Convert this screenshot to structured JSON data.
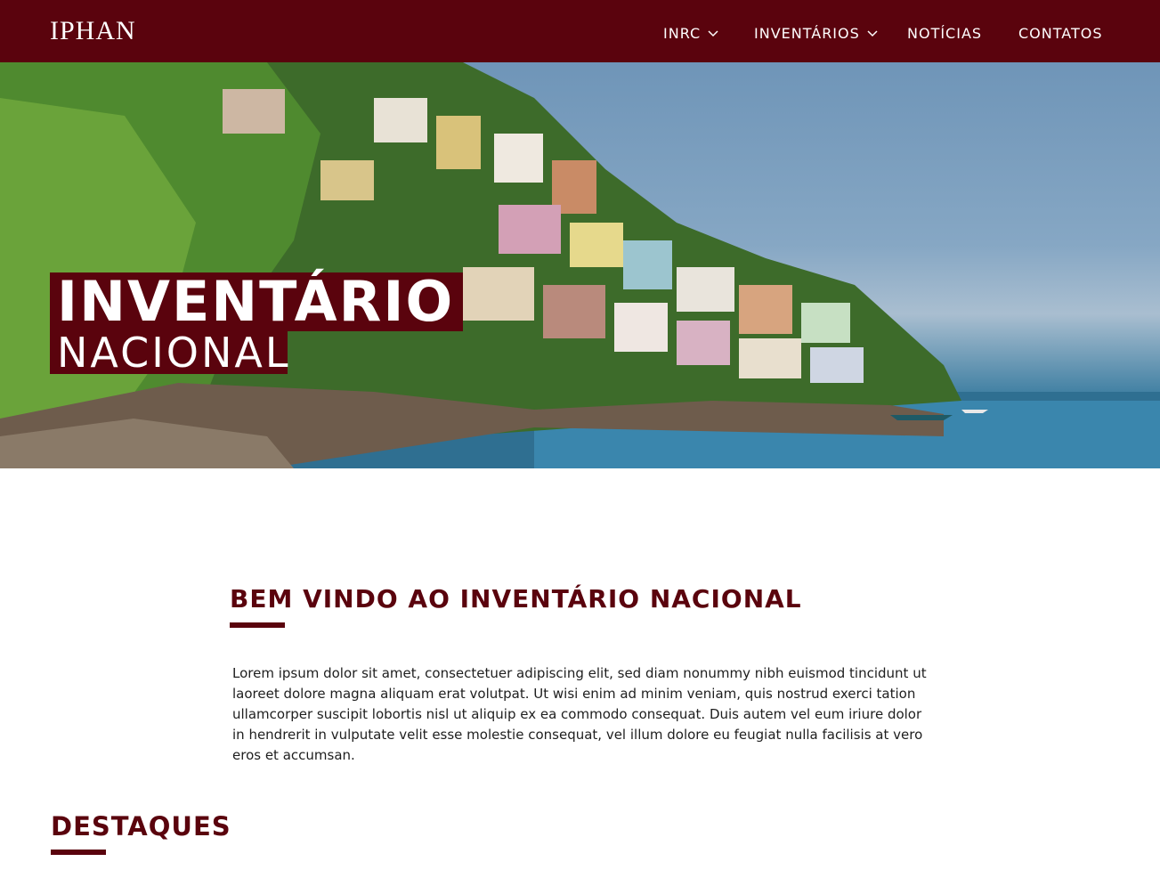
{
  "header": {
    "logo": "IPHAN",
    "nav": [
      {
        "label": "INRC",
        "has_dropdown": true
      },
      {
        "label": "INVENTÁRIOS",
        "has_dropdown": true
      },
      {
        "label": "NOTÍCIAS",
        "has_dropdown": false
      },
      {
        "label": "CONTATOS",
        "has_dropdown": false
      }
    ]
  },
  "hero": {
    "title_line1": "INVENTÁRIO",
    "title_line2": "NACIONAL"
  },
  "welcome": {
    "title": "BEM VINDO AO INVENTÁRIO NACIONAL",
    "body": "Lorem ipsum dolor sit amet, consectetuer adipiscing elit, sed diam nonummy nibh euismod tincidunt ut laoreet dolore magna aliquam erat volutpat. Ut wisi enim ad minim veniam, quis nostrud exerci tation ullamcorper suscipit lobortis nisl ut aliquip ex ea commodo consequat. Duis autem vel eum iriure dolor in hendrerit in vulputate velit esse molestie consequat, vel illum dolore eu feugiat nulla facilisis at vero eros et accumsan."
  },
  "highlights": {
    "title": "DESTAQUES"
  },
  "colors": {
    "brand": "#5a030d",
    "header_text": "#ffffff"
  }
}
